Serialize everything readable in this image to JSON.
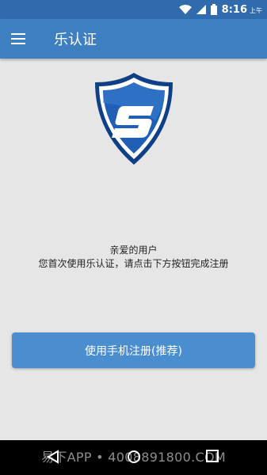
{
  "status_bar": {
    "time": "8:16",
    "ampm": "上午",
    "icons": [
      "wifi-icon",
      "signal-icon",
      "battery-icon"
    ]
  },
  "toolbar": {
    "title": "乐认证",
    "menu_icon": "hamburger-menu-icon"
  },
  "logo": {
    "name": "shield-s-logo",
    "letter": "S"
  },
  "welcome": {
    "line1": "亲爱的用户",
    "line2": "您首次使用乐认证，请点击下方按钮完成注册"
  },
  "register_button": {
    "label": "使用手机注册(推荐)"
  },
  "nav_bar": {
    "icons": [
      "back-icon",
      "home-icon",
      "recent-apps-icon"
    ]
  },
  "watermark": {
    "text": "易下APP • 4008891800.COM"
  },
  "colors": {
    "status_bar": "#2f6bad",
    "toolbar": "#3d7fc1",
    "button": "#4a8ed0",
    "background": "#e6e6e6",
    "shield": "#1f5fb5"
  }
}
